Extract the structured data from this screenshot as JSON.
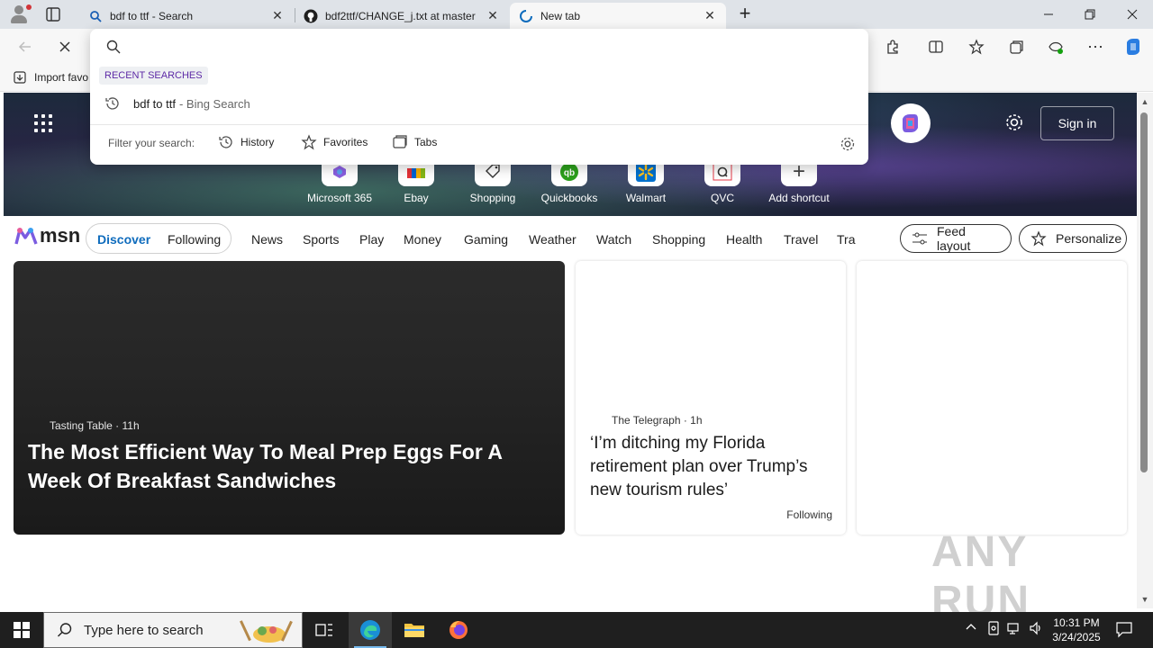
{
  "tabs": [
    {
      "title": "bdf to ttf - Search",
      "icon": "search-icon"
    },
    {
      "title": "bdf2ttf/CHANGE_j.txt at master",
      "icon": "github-icon"
    },
    {
      "title": "New tab",
      "icon": "loading-icon"
    }
  ],
  "favorites_bar": {
    "import_label": "Import favo"
  },
  "omnibox": {
    "value": "",
    "recent_header": "RECENT SEARCHES",
    "recent": [
      {
        "query": "bdf to ttf",
        "suffix": "- Bing Search"
      }
    ],
    "filter_label": "Filter your search:",
    "filters": [
      "History",
      "Favorites",
      "Tabs"
    ]
  },
  "hero": {
    "sign_in": "Sign in",
    "shortcuts": [
      "Microsoft 365",
      "Ebay",
      "Shopping",
      "Quickbooks",
      "Walmart",
      "QVC",
      "Add shortcut"
    ]
  },
  "msn": {
    "logo": "msn",
    "segments": [
      "Discover",
      "Following"
    ],
    "nav": [
      "News",
      "Sports",
      "Play",
      "Money",
      "Gaming",
      "Weather",
      "Watch",
      "Shopping",
      "Health",
      "Travel",
      "Tra"
    ],
    "feed_layout": "Feed layout",
    "personalize": "Personalize"
  },
  "cards": [
    {
      "source": "Tasting Table",
      "age": "11h",
      "headline": "The Most Efficient Way To Meal Prep Eggs For A Week Of Breakfast Sandwiches"
    },
    {
      "source": "The Telegraph",
      "age": "1h",
      "headline": "‘I’m ditching my Florida retirement plan over Trump’s new tourism rules’",
      "tag": "Following"
    }
  ],
  "watermark": "ANY RUN",
  "taskbar": {
    "search_placeholder": "Type here to search",
    "time": "10:31 PM",
    "date": "3/24/2025"
  },
  "colors": {
    "accent": "#0f6cbd",
    "recent_header": "#5d2aa6",
    "taskbar": "#1f1f1f"
  }
}
